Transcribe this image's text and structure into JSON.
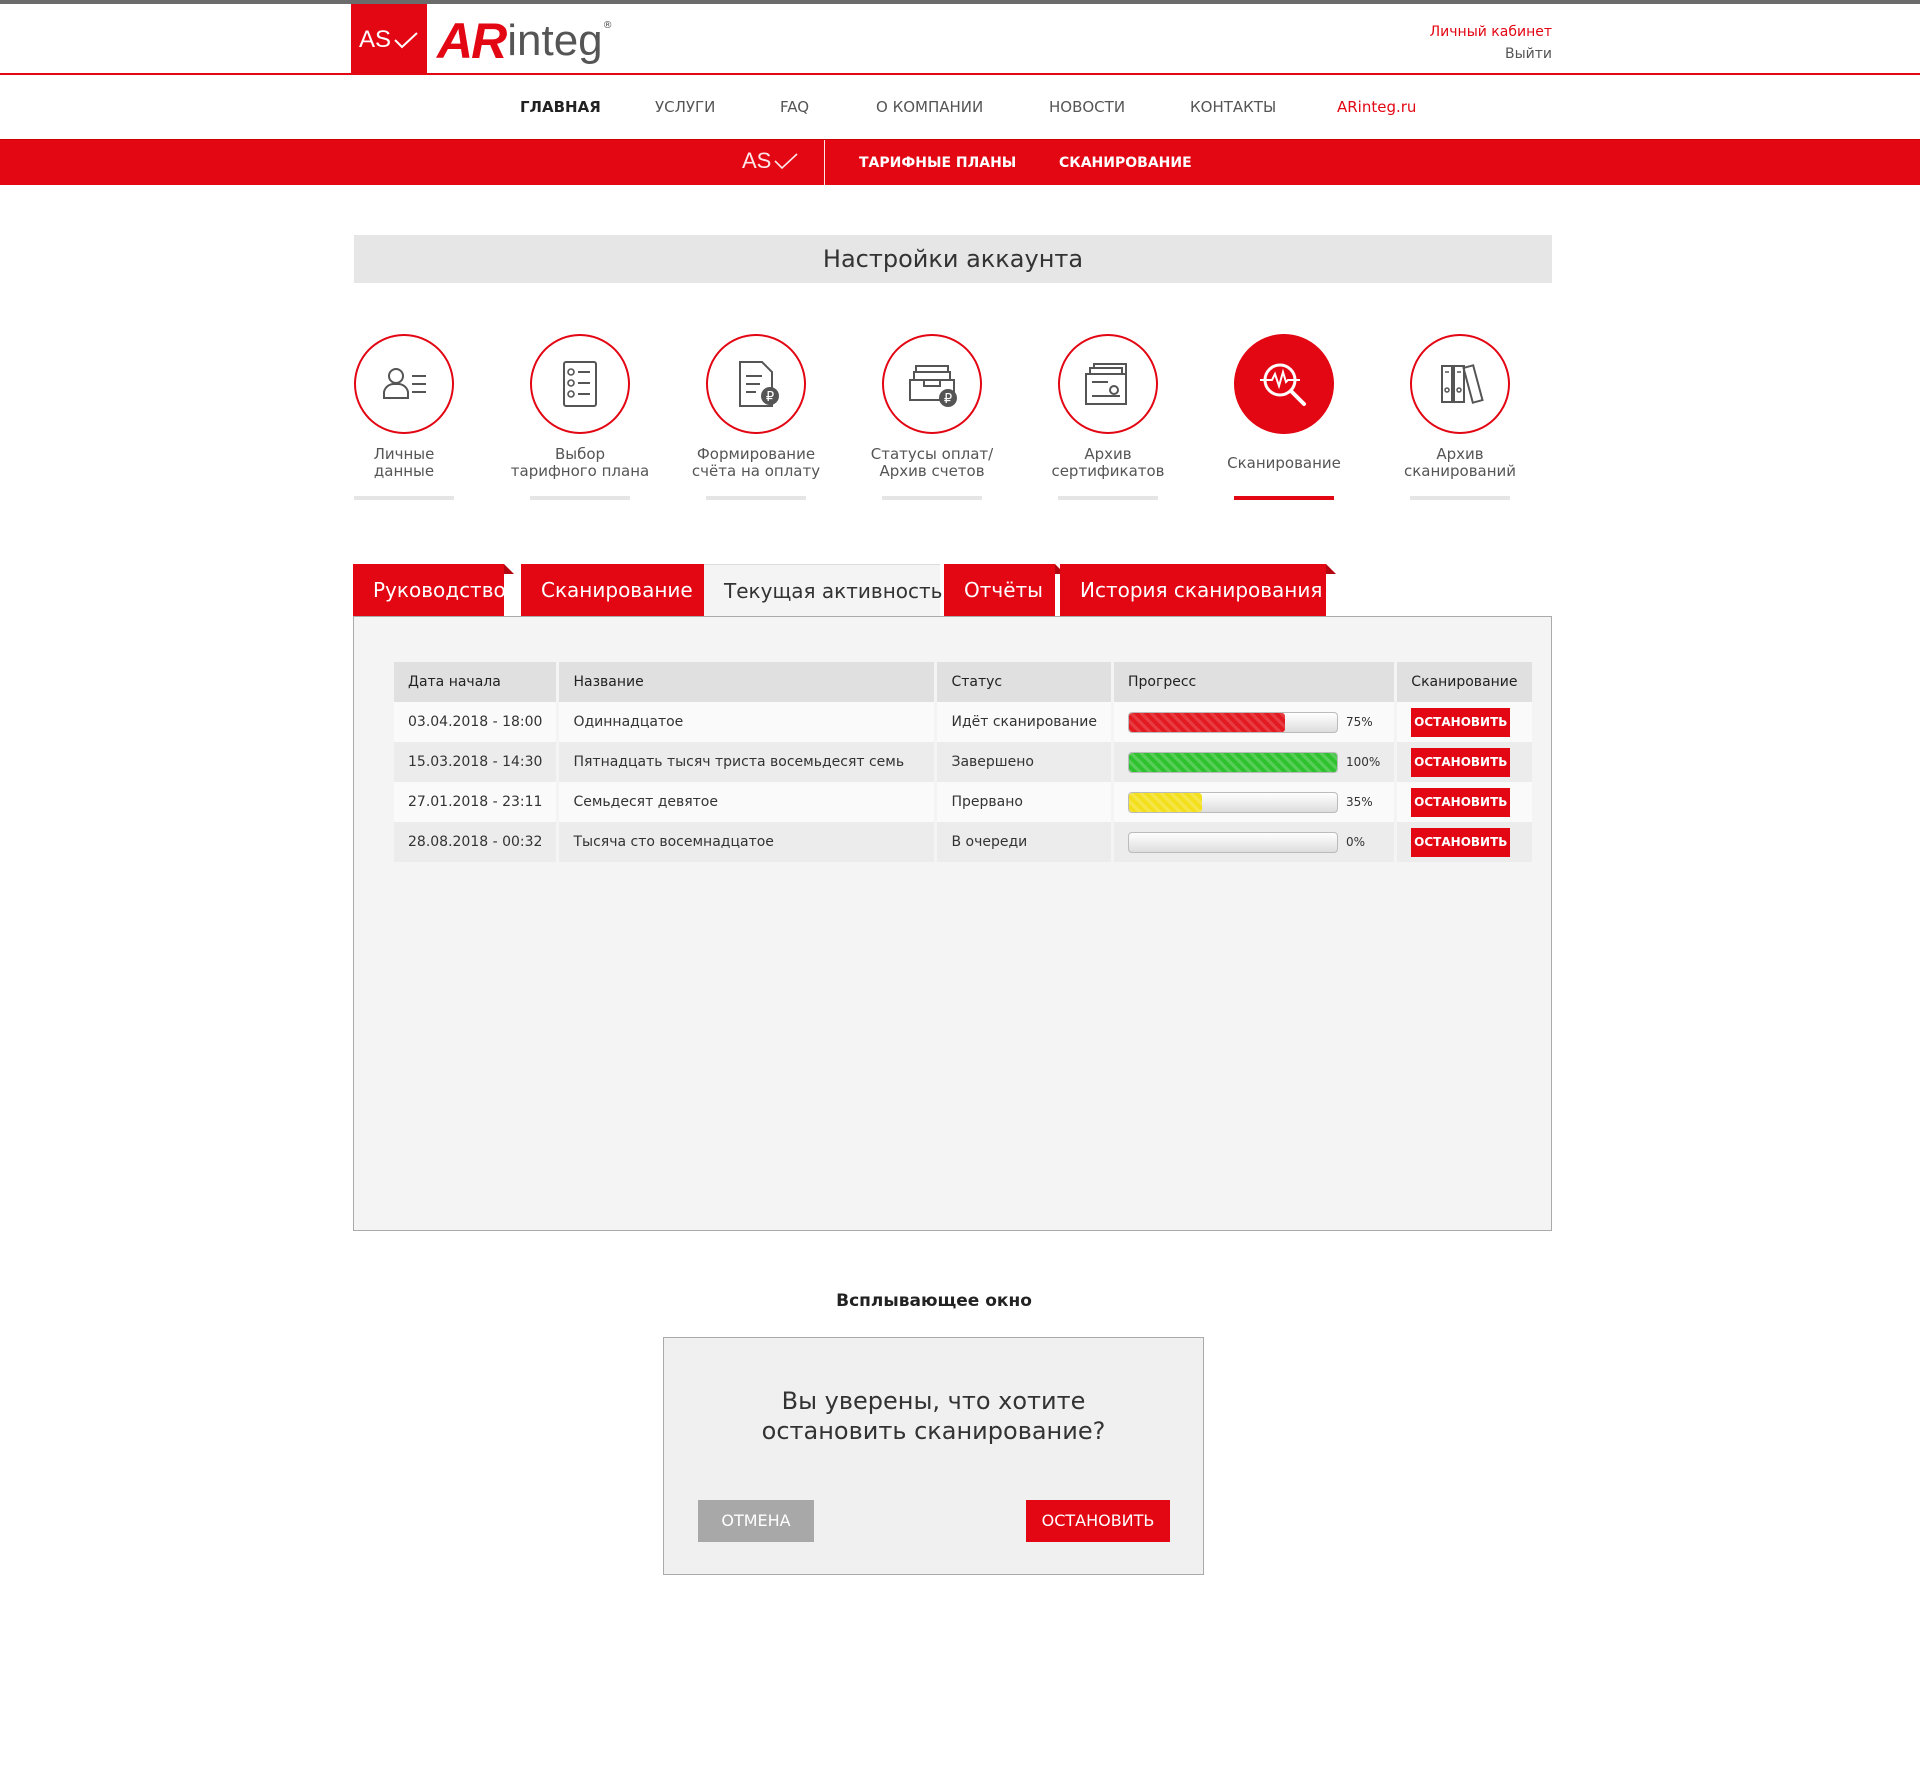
{
  "header": {
    "logo_as": "AS",
    "logo_ar": "AR",
    "logo_integ": "integ",
    "logo_reg": "®",
    "account_link": "Личный кабинет",
    "logout_link": "Выйти"
  },
  "main_nav": [
    "ГЛАВНАЯ",
    "УСЛУГИ",
    "FAQ",
    "О КОМПАНИИ",
    "НОВОСТИ",
    "КОНТАКТЫ",
    "ARinteg.ru"
  ],
  "sub_nav": {
    "logo": "AS",
    "items": [
      "ТАРИФНЫЕ ПЛАНЫ",
      "СКАНИРОВАНИЕ"
    ]
  },
  "page_title": "Настройки аккаунта",
  "menu": [
    {
      "line1": "Личные",
      "line2": "данные",
      "icon": "user-list-icon"
    },
    {
      "line1": "Выбор",
      "line2": "тарифного плана",
      "icon": "checklist-icon"
    },
    {
      "line1": "Формирование",
      "line2": "счёта на оплату",
      "icon": "invoice-ruble-icon"
    },
    {
      "line1": "Статусы оплат/",
      "line2": "Архив счетов",
      "icon": "inbox-ruble-icon"
    },
    {
      "line1": "Архив",
      "line2": "сертификатов",
      "icon": "certificate-archive-icon"
    },
    {
      "line1": "Сканирование",
      "line2": "",
      "icon": "magnifier-pulse-icon"
    },
    {
      "line1": "Архив",
      "line2": "сканирований",
      "icon": "binders-icon"
    }
  ],
  "tabs": [
    "Руководство",
    "Сканирование",
    "Текущая активность",
    "Отчёты",
    "История сканирования"
  ],
  "table": {
    "headers": [
      "Дата начала",
      "Название",
      "Статус",
      "Прогресс",
      "Сканирование"
    ],
    "rows": [
      {
        "date": "03.04.2018 - 18:00",
        "name": "Одиннадцатое",
        "status": "Идёт сканирование",
        "progress": 75,
        "progress_label": "75%",
        "color": "red",
        "action": "ОСТАНОВИТЬ"
      },
      {
        "date": "15.03.2018 - 14:30",
        "name": "Пятнадцать тысяч триста восемьдесят семь",
        "status": "Завершено",
        "progress": 100,
        "progress_label": "100%",
        "color": "green",
        "action": "ОСТАНОВИТЬ"
      },
      {
        "date": "27.01.2018 - 23:11",
        "name": "Семьдесят девятое",
        "status": "Прервано",
        "progress": 35,
        "progress_label": "35%",
        "color": "yellow",
        "action": "ОСТАНОВИТЬ"
      },
      {
        "date": "28.08.2018 - 00:32",
        "name": "Тысяча сто восемнадцатое",
        "status": "В очереди",
        "progress": 0,
        "progress_label": "0%",
        "color": "none",
        "action": "ОСТАНОВИТЬ"
      }
    ]
  },
  "popup": {
    "section_title": "Всплывающее окно",
    "question_line1": "Вы уверены, что хотите",
    "question_line2": "остановить сканирование?",
    "cancel_label": "ОТМЕНА",
    "stop_label": "ОСТАНОВИТЬ"
  },
  "colors": {
    "accent": "#e30613",
    "bar_bg": "#e6e6e6",
    "panel_bg": "#f4f4f4"
  }
}
